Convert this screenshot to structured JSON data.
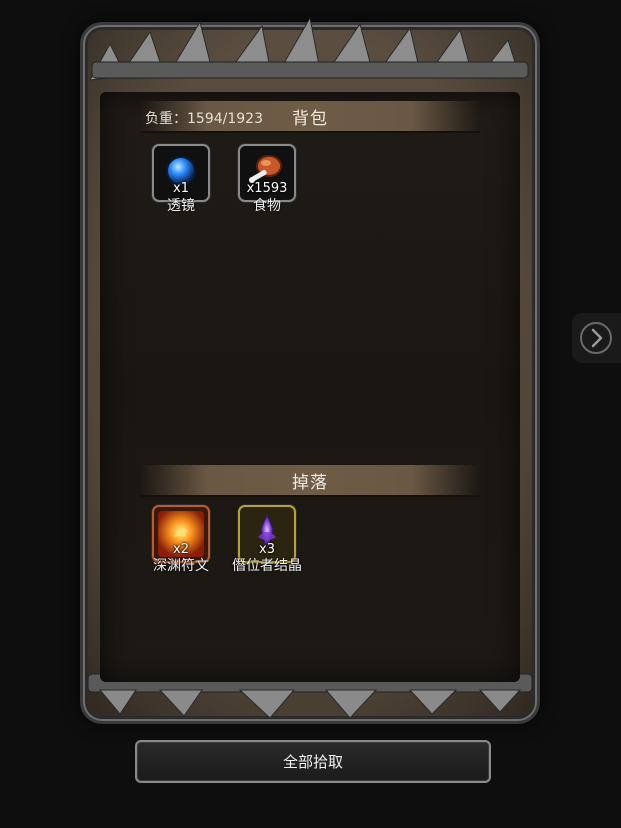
{
  "backpack": {
    "title": "背包",
    "weight_text": "负重：1594/1923",
    "items": [
      {
        "name": "透镜",
        "qty": "x1",
        "icon": "blue-orb-icon"
      },
      {
        "name": "食物",
        "qty": "x1593",
        "icon": "roast-meat-icon"
      }
    ]
  },
  "drops": {
    "title": "掉落",
    "items": [
      {
        "name": "深渊符文",
        "qty": "x2",
        "icon": "fire-rune-icon"
      },
      {
        "name": "僭位者结晶",
        "qty": "x3",
        "icon": "purple-crystal-icon"
      }
    ]
  },
  "actions": {
    "pick_all_label": "全部拾取"
  },
  "nav": {
    "next_icon": "chevron-right-icon"
  },
  "colors": {
    "frame": "#4a3f33",
    "panel": "#1d1914",
    "section_bar": "#6f5c47"
  }
}
